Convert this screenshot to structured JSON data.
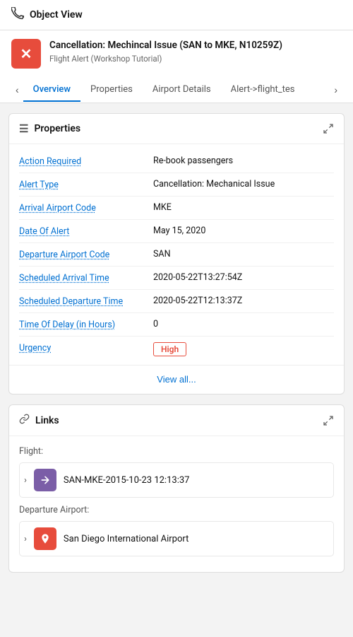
{
  "topBar": {
    "title": "Object View",
    "icon": "plane-icon"
  },
  "header": {
    "title": "Cancellation: Mechincal Issue (SAN to MKE, N10259Z)",
    "subtitle": "Flight Alert (Workshop Tutorial)",
    "iconAlt": "alert-icon"
  },
  "tabs": {
    "prev_label": "‹",
    "next_label": "›",
    "items": [
      {
        "label": "Overview",
        "active": true
      },
      {
        "label": "Properties",
        "active": false
      },
      {
        "label": "Airport Details",
        "active": false
      },
      {
        "label": "Alert->flight_tes",
        "active": false
      }
    ]
  },
  "propertiesCard": {
    "title": "Properties",
    "expand_label": "⤢",
    "rows": [
      {
        "label": "Action Required",
        "value": "Re-book passengers"
      },
      {
        "label": "Alert Type",
        "value": "Cancellation: Mechanical Issue"
      },
      {
        "label": "Arrival Airport Code",
        "value": "MKE"
      },
      {
        "label": "Date Of Alert",
        "value": "May 15, 2020"
      },
      {
        "label": "Departure Airport Code",
        "value": "SAN"
      },
      {
        "label": "Scheduled Arrival Time",
        "value": "2020-05-22T13:27:54Z"
      },
      {
        "label": "Scheduled Departure Time",
        "value": "2020-05-22T12:13:37Z"
      },
      {
        "label": "Time Of Delay (in Hours)",
        "value": "0"
      },
      {
        "label": "Urgency",
        "value": "High",
        "badge": true
      }
    ],
    "viewAll": "View all..."
  },
  "linksCard": {
    "title": "Links",
    "expand_label": "⤢",
    "sections": [
      {
        "label": "Flight:",
        "items": [
          {
            "text": "SAN-MKE-2015-10-23 12:13:37",
            "iconType": "purple",
            "iconSymbol": "arrow-icon"
          }
        ]
      },
      {
        "label": "Departure Airport:",
        "items": [
          {
            "text": "San Diego International Airport",
            "iconType": "red",
            "iconSymbol": "pin-icon"
          }
        ]
      }
    ]
  }
}
